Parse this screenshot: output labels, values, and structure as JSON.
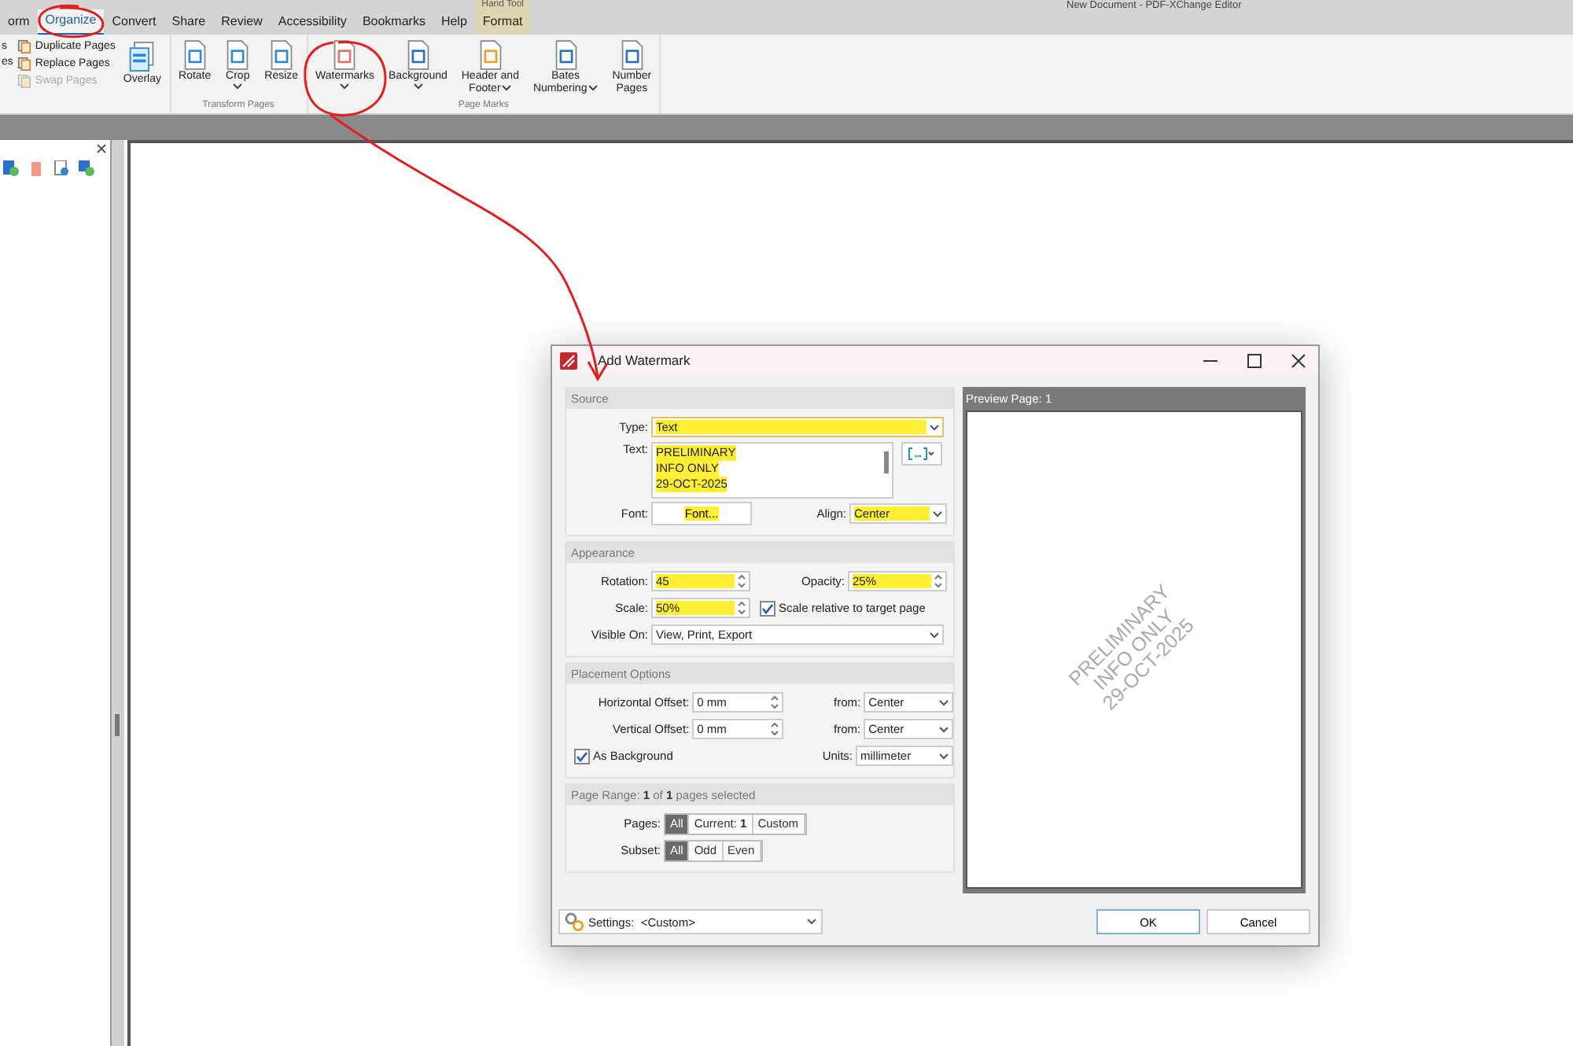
{
  "app": {
    "title": "New Document  -  PDF-XChange Editor",
    "context_group": "Hand Tool"
  },
  "ribbon_tabs": [
    {
      "label": "orm",
      "selected": false
    },
    {
      "label": "Organize",
      "selected": true
    },
    {
      "label": "Convert",
      "selected": false
    },
    {
      "label": "Share",
      "selected": false
    },
    {
      "label": "Review",
      "selected": false
    },
    {
      "label": "Accessibility",
      "selected": false
    },
    {
      "label": "Bookmarks",
      "selected": false
    },
    {
      "label": "Help",
      "selected": false
    },
    {
      "label": "Format",
      "selected": false
    }
  ],
  "ribbon": {
    "cut_labels": [
      "s",
      "es"
    ],
    "small_buttons": [
      {
        "label": "Duplicate Pages",
        "disabled": false
      },
      {
        "label": "Replace Pages",
        "disabled": false
      },
      {
        "label": "Swap Pages",
        "disabled": true
      }
    ],
    "overlay": {
      "lines": [
        "Overlay"
      ]
    },
    "groups": [
      {
        "label": "Transform Pages",
        "buttons": [
          {
            "lines": [
              "Rotate"
            ],
            "dropdown": false
          },
          {
            "lines": [
              "Crop"
            ],
            "dropdown": true
          },
          {
            "lines": [
              "Resize"
            ],
            "dropdown": false
          }
        ]
      },
      {
        "label": "Page Marks",
        "buttons": [
          {
            "lines": [
              "Watermarks"
            ],
            "dropdown": true
          },
          {
            "lines": [
              "Background"
            ],
            "dropdown": true
          },
          {
            "lines": [
              "Header and",
              "Footer"
            ],
            "dropdown": true
          },
          {
            "lines": [
              "Bates",
              "Numbering"
            ],
            "dropdown": true
          },
          {
            "lines": [
              "Number",
              "Pages"
            ],
            "dropdown": false
          }
        ]
      }
    ]
  },
  "dialog": {
    "title": "Add Watermark",
    "source": {
      "heading": "Source",
      "type": {
        "label": "Type:",
        "value": "Text",
        "highlighted": true
      },
      "text": {
        "label": "Text:",
        "lines": [
          "PRELIMINARY",
          "INFO ONLY",
          "29-OCT-2025"
        ],
        "highlighted": true
      },
      "font": {
        "label": "Font:",
        "button": "Font...",
        "highlighted": true
      },
      "align": {
        "label": "Align:",
        "value": "Center",
        "highlighted": true
      }
    },
    "appearance": {
      "heading": "Appearance",
      "rotation": {
        "label": "Rotation:",
        "value": "45",
        "highlighted": true
      },
      "opacity": {
        "label": "Opacity:",
        "value": "25%",
        "highlighted": true
      },
      "scale": {
        "label": "Scale:",
        "value": "50%",
        "highlighted": true
      },
      "scale_relative": {
        "label": "Scale relative to target page",
        "checked": true
      },
      "visible_on": {
        "label": "Visible On:",
        "value": "View, Print, Export"
      }
    },
    "placement": {
      "heading": "Placement Options",
      "h_offset": {
        "label": "Horizontal Offset:",
        "value": "0 mm"
      },
      "h_from": {
        "label": "from:",
        "value": "Center"
      },
      "v_offset": {
        "label": "Vertical Offset:",
        "value": "0 mm"
      },
      "v_from": {
        "label": "from:",
        "value": "Center"
      },
      "as_background": {
        "label": "As Background",
        "checked": true
      },
      "units": {
        "label": "Units:",
        "value": "millimeter"
      }
    },
    "page_range": {
      "heading": "Page Range: **1** of **1** pages selected",
      "pages": {
        "label": "Pages:",
        "options": [
          {
            "label": "All",
            "selected": true
          },
          {
            "label": "Current: **1**",
            "selected": false
          },
          {
            "label": "Custom",
            "selected": false
          }
        ]
      },
      "subset": {
        "label": "Subset:",
        "options": [
          {
            "label": "All",
            "selected": true
          },
          {
            "label": "Odd",
            "selected": false
          },
          {
            "label": "Even",
            "selected": false
          }
        ]
      }
    },
    "preview": {
      "heading": "Preview Page: 1",
      "watermark_lines": [
        "PRELIMINARY",
        "INFO ONLY",
        "29-OCT-2025"
      ]
    },
    "settings": {
      "label": "Settings:",
      "value": "<Custom>"
    },
    "buttons": [
      "OK",
      "Cancel"
    ]
  }
}
